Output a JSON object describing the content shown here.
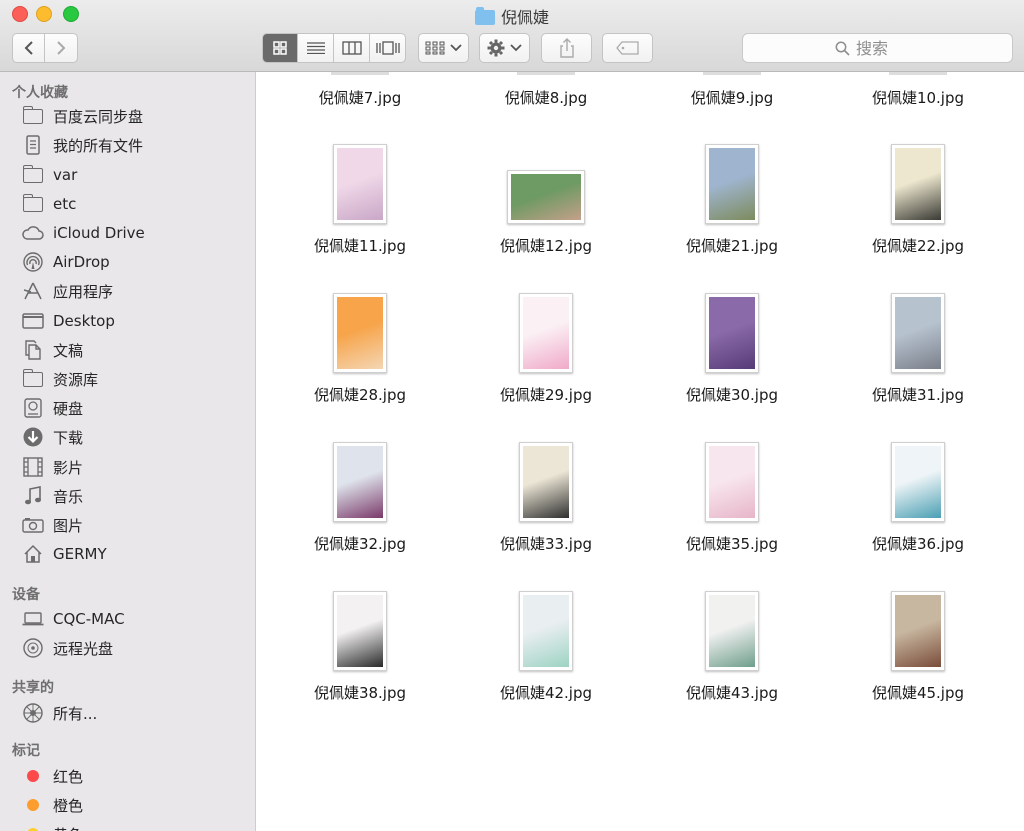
{
  "window": {
    "title": "倪佩婕"
  },
  "toolbar": {
    "back_icon": "chevron-left-icon",
    "forward_icon": "chevron-right-icon",
    "view_icons": [
      "icon-view-icon",
      "list-view-icon",
      "column-view-icon",
      "cover-flow-icon"
    ],
    "arrange_icon": "grid-arrange-icon",
    "action_icon": "gear-icon",
    "share_icon": "share-icon",
    "tag_icon": "tag-icon",
    "search_placeholder": "搜索"
  },
  "sidebar": {
    "favorites_title": "个人收藏",
    "favorites": [
      {
        "label": "百度云同步盘",
        "icon": "folder-icon"
      },
      {
        "label": "我的所有文件",
        "icon": "all-files-icon"
      },
      {
        "label": "var",
        "icon": "folder-icon"
      },
      {
        "label": "etc",
        "icon": "folder-icon"
      },
      {
        "label": "iCloud Drive",
        "icon": "cloud-icon"
      },
      {
        "label": "AirDrop",
        "icon": "airdrop-icon"
      },
      {
        "label": "应用程序",
        "icon": "applications-icon"
      },
      {
        "label": "Desktop",
        "icon": "desktop-icon"
      },
      {
        "label": "文稿",
        "icon": "documents-icon"
      },
      {
        "label": "资源库",
        "icon": "folder-icon"
      },
      {
        "label": "硬盘",
        "icon": "hard-drive-icon"
      },
      {
        "label": "下载",
        "icon": "download-icon"
      },
      {
        "label": "影片",
        "icon": "movies-icon"
      },
      {
        "label": "音乐",
        "icon": "music-icon"
      },
      {
        "label": "图片",
        "icon": "pictures-icon"
      },
      {
        "label": "GERMY",
        "icon": "home-icon"
      }
    ],
    "devices_title": "设备",
    "devices": [
      {
        "label": "CQC-MAC",
        "icon": "laptop-icon"
      },
      {
        "label": "远程光盘",
        "icon": "disc-icon"
      }
    ],
    "shared_title": "共享的",
    "shared": [
      {
        "label": "所有...",
        "icon": "network-icon"
      }
    ],
    "tags_title": "标记",
    "tags": [
      {
        "label": "红色",
        "color": "#fc4a4a"
      },
      {
        "label": "橙色",
        "color": "#fd9d2d"
      },
      {
        "label": "黄色",
        "color": "#fdd02e"
      }
    ]
  },
  "files": {
    "top_row": [
      "倪佩婕7.jpg",
      "倪佩婕8.jpg",
      "倪佩婕9.jpg",
      "倪佩婕10.jpg"
    ],
    "grid": [
      {
        "name": "倪佩婕11.jpg",
        "colors": [
          "#f0d8e8",
          "#c9a7c7"
        ]
      },
      {
        "name": "倪佩婕12.jpg",
        "colors": [
          "#6e9a63",
          "#c4a08a"
        ]
      },
      {
        "name": "倪佩婕21.jpg",
        "colors": [
          "#9fb5cf",
          "#7d8b5d"
        ]
      },
      {
        "name": "倪佩婕22.jpg",
        "colors": [
          "#ede7cf",
          "#3a3a34"
        ]
      },
      {
        "name": "倪佩婕28.jpg",
        "colors": [
          "#f7a44a",
          "#f4d6b4"
        ]
      },
      {
        "name": "倪佩婕29.jpg",
        "colors": [
          "#fbf0f4",
          "#f0a9c9"
        ]
      },
      {
        "name": "倪佩婕30.jpg",
        "colors": [
          "#8a6aa8",
          "#563b77"
        ]
      },
      {
        "name": "倪佩婕31.jpg",
        "colors": [
          "#b7c2cf",
          "#7a808a"
        ]
      },
      {
        "name": "倪佩婕32.jpg",
        "colors": [
          "#dfe4ec",
          "#7a3a6a"
        ]
      },
      {
        "name": "倪佩婕33.jpg",
        "colors": [
          "#ece6d6",
          "#2f2f2f"
        ]
      },
      {
        "name": "倪佩婕35.jpg",
        "colors": [
          "#f8e6ee",
          "#e7b5c8"
        ]
      },
      {
        "name": "倪佩婕36.jpg",
        "colors": [
          "#eef4f7",
          "#4b9fb3"
        ]
      },
      {
        "name": "倪佩婕38.jpg",
        "colors": [
          "#f3f1f1",
          "#2a2a2a"
        ]
      },
      {
        "name": "倪佩婕42.jpg",
        "colors": [
          "#e9eef0",
          "#9dd3c3"
        ]
      },
      {
        "name": "倪佩婕43.jpg",
        "colors": [
          "#f1f1f0",
          "#6f9e8c"
        ]
      },
      {
        "name": "倪佩婕45.jpg",
        "colors": [
          "#c8b7a0",
          "#7a4d3a"
        ]
      }
    ],
    "bottom_row": [
      {
        "colors": [
          "#f9f3f2",
          "#e58aa7"
        ]
      },
      {
        "colors": [
          "#f3f3f3",
          "#3a3a3a"
        ]
      },
      {
        "colors": [
          "#f5ecec",
          "#d04b4b"
        ]
      },
      {
        "colors": [
          "#f2f1ef",
          "#9a9086"
        ]
      }
    ]
  }
}
